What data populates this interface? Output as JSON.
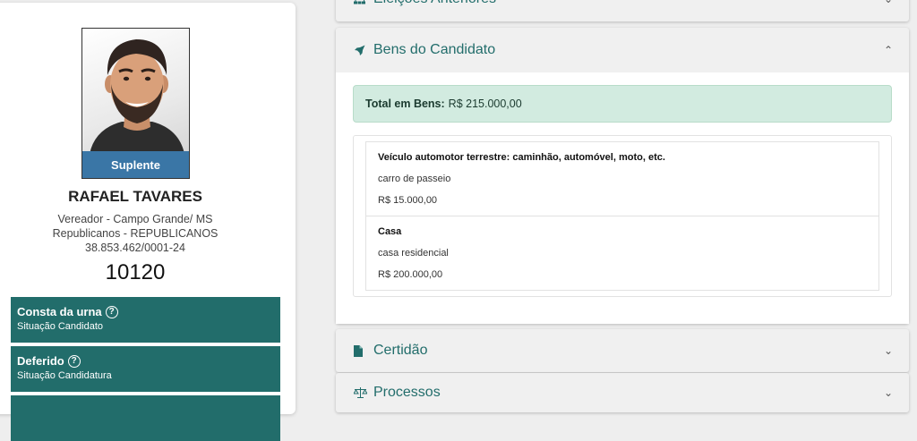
{
  "candidate": {
    "photo_badge": "Suplente",
    "name": "RAFAEL TAVARES",
    "role": "Vereador - Campo Grande/ MS",
    "party": "Republicanos - REPUBLICANOS",
    "cnpj": "38.853.462/0001-24",
    "number": "10120"
  },
  "status": [
    {
      "title": "Consta da urna",
      "subtitle": "Situação Candidato"
    },
    {
      "title": "Deferido",
      "subtitle": "Situação Candidatura"
    }
  ],
  "sections": {
    "previous_elections": {
      "label": "Eleições Anteriores",
      "icon": "sitemap-icon"
    },
    "assets": {
      "label": "Bens do Candidato",
      "icon": "rocket-icon",
      "total_label": "Total em Bens:",
      "total_value": "R$ 215.000,00",
      "items": [
        {
          "type": "Veículo automotor terrestre: caminhão, automóvel, moto, etc.",
          "description": "carro de passeio",
          "value": "R$ 15.000,00"
        },
        {
          "type": "Casa",
          "description": "casa residencial",
          "value": "R$ 200.000,00"
        }
      ]
    },
    "certificate": {
      "label": "Certidão",
      "icon": "file-icon"
    },
    "processes": {
      "label": "Processos",
      "icon": "balance-scale-icon"
    }
  },
  "colors": {
    "accent": "#226d6b",
    "badge": "#3a76a6",
    "total_bg": "#d2ebe0"
  }
}
